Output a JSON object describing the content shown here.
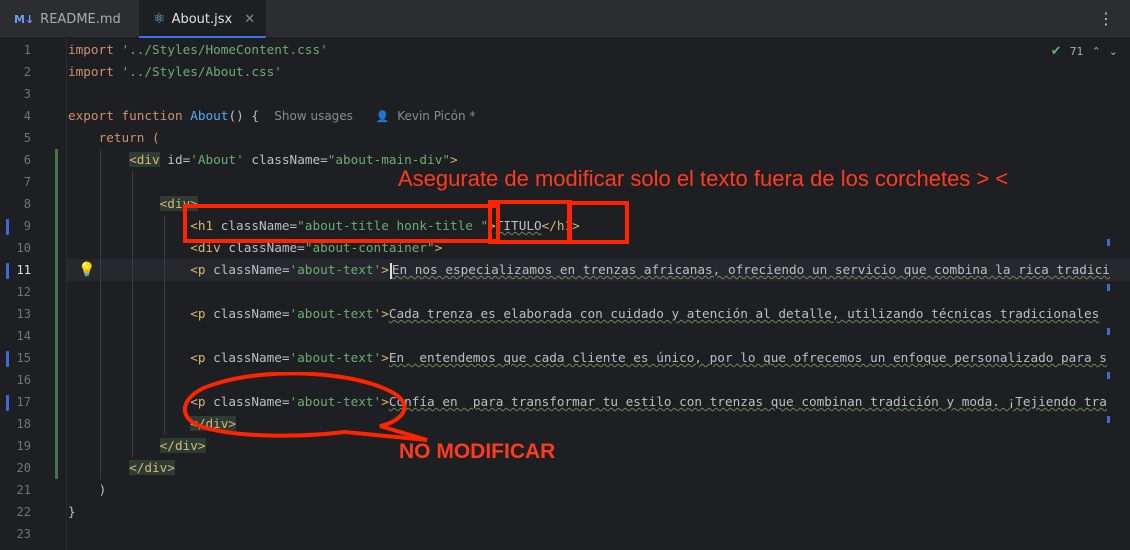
{
  "tabs": [
    {
      "label": "README.md",
      "badge": "M↓",
      "active": false
    },
    {
      "label": "About.jsx",
      "active": true
    }
  ],
  "inspection": {
    "count": "71"
  },
  "line_numbers": [
    "1",
    "2",
    "3",
    "4",
    "5",
    "6",
    "7",
    "8",
    "9",
    "10",
    "11",
    "12",
    "13",
    "14",
    "15",
    "16",
    "17",
    "18",
    "19",
    "20",
    "21",
    "22",
    "23"
  ],
  "code": {
    "l1_kw": "import",
    "l1_str": "'../Styles/HomeContent.css'",
    "l2_kw": "import",
    "l2_str": "'../Styles/About.css'",
    "l4_kw1": "export",
    "l4_kw2": "function",
    "l4_fn": "About",
    "l4_rest": "() {",
    "l4_hint_usages": "Show usages",
    "l4_hint_author": "Kevin Picón *",
    "l5": "return (",
    "l6_open": "<div",
    "l6_attr1": " id=",
    "l6_val1": "'About'",
    "l6_attr2": " className=",
    "l6_val2": "\"about-main-div\"",
    "l6_close": ">",
    "l8": "<div>",
    "l9_open": "<h1",
    "l9_attr": " className=",
    "l9_val": "\"about-title honk-title \"",
    "l9_gt": ">",
    "l9_text": "TITULO",
    "l9_close": "</h1>",
    "l10_open": "<div",
    "l10_attr": " className=",
    "l10_val": "\"about-container\"",
    "l10_close": ">",
    "l11_open": "<p",
    "l11_attr": " className=",
    "l11_val": "'about-text'",
    "l11_gt": ">",
    "l11_text": "En nos especializamos en trenzas africanas, ofreciendo un servicio que combina la rica tradici",
    "l13_open": "<p",
    "l13_attr": " className=",
    "l13_val": "'about-text'",
    "l13_gt": ">",
    "l13_text": "Cada trenza es elaborada con cuidado y atención al detalle, utilizando técnicas tradicionales",
    "l15_open": "<p",
    "l15_attr": " className=",
    "l15_val": "'about-text'",
    "l15_gt": ">",
    "l15_text": "En  entendemos que cada cliente es único, por lo que ofrecemos un enfoque personalizado para s",
    "l17_open": "<p",
    "l17_attr": " className=",
    "l17_val": "'about-text'",
    "l17_gt": ">",
    "l17_text": "Confía en  para transformar tu estilo con trenzas que combinan tradición y moda. ¡Tejiendo tra",
    "l18": "</div>",
    "l19": "</div>",
    "l20": "</div>",
    "l21": ")",
    "l22": "}"
  },
  "annotations": {
    "top_text": "Asegurate de modificar solo el texto fuera de los corchetes > <",
    "bottom_text": "NO MODIFICAR",
    "color": "#ff2400"
  },
  "colors": {
    "background": "#1e1f22",
    "tabbar": "#2b2d30",
    "keyword": "#cf8e6d",
    "string": "#6aab73",
    "function": "#56a8f5",
    "tag": "#d5b778",
    "accent": "#3574f0"
  }
}
